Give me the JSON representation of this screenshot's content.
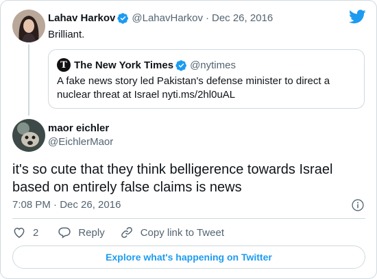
{
  "parent_tweet": {
    "name": "Lahav Harkov",
    "handle": "@LahavHarkov",
    "separator": "·",
    "date": "Dec 26, 2016",
    "text": "Brilliant.",
    "avatar_icon": "woman-portrait-avatar"
  },
  "quoted_tweet": {
    "name": "The New York Times",
    "handle": "@nytimes",
    "logo_letter": "T",
    "text": "A fake news story led Pakistan's defense minister to direct a nuclear threat at Israel nyti.ms/2hl0uAL"
  },
  "reply_tweet": {
    "name": "maor eichler",
    "handle": "@EichlerMaor",
    "avatar_icon": "dog-portrait-avatar",
    "text": "it's so cute that they think belligerence towards Israel based on entirely false claims is news",
    "timestamp": "7:08 PM · Dec 26, 2016"
  },
  "actions": {
    "like_count": "2",
    "reply_label": "Reply",
    "copy_label": "Copy link to Tweet"
  },
  "footer": {
    "explore_label": "Explore what's happening on Twitter"
  },
  "colors": {
    "brand_blue": "#1d9bf0",
    "text_secondary": "#536471",
    "border": "#cfd9de"
  }
}
